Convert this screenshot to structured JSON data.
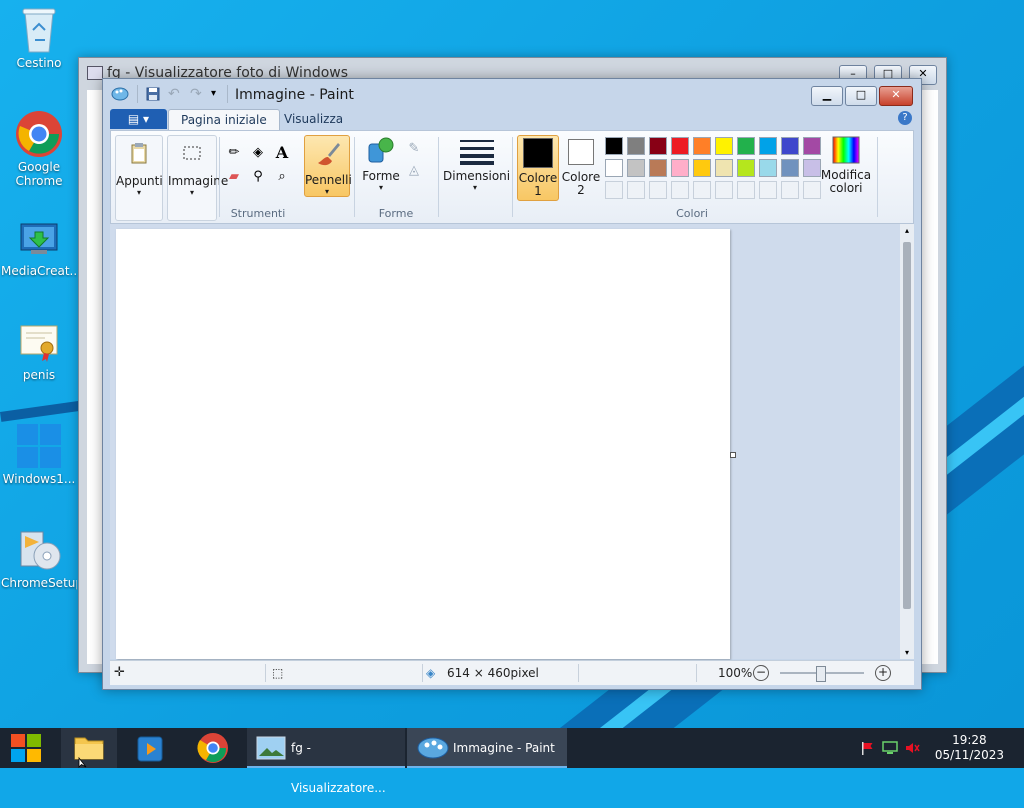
{
  "desktop": {
    "icons": [
      {
        "label": "Cestino",
        "icon": "recycle-bin-icon"
      },
      {
        "label": "Google Chrome",
        "icon": "chrome-icon"
      },
      {
        "label": "MediaCreat...",
        "icon": "media-creation-tool-icon"
      },
      {
        "label": "penis",
        "icon": "certificate-icon"
      },
      {
        "label": "Windows1...",
        "icon": "windows-logo-icon"
      },
      {
        "label": "ChromeSetup",
        "icon": "installer-icon"
      }
    ]
  },
  "viewer_window": {
    "title": "fg - Visualizzatore foto di Windows"
  },
  "paint": {
    "title": "Immagine - Paint",
    "quick_access": [
      "save-icon",
      "undo-icon",
      "redo-icon",
      "customize-dropdown-icon"
    ],
    "tabs": {
      "active": "Pagina iniziale",
      "other": "Visualizza"
    },
    "groups": {
      "appunti": "Appunti",
      "immagine": "Immagine",
      "strumenti": "Strumenti",
      "pennelli": "Pennelli",
      "forme_btn": "Forme",
      "forme_group": "Forme",
      "dimensioni": "Dimensioni",
      "colore1": "Colore 1",
      "colore2": "Colore 2",
      "colori": "Colori",
      "modifica": "Modifica colori"
    },
    "palette_row1": [
      "#000000",
      "#7f7f7f",
      "#880015",
      "#ed1c24",
      "#ff7f27",
      "#fff200",
      "#22b14c",
      "#00a2e8",
      "#3f48cc",
      "#a349a4"
    ],
    "palette_row2": [
      "#ffffff",
      "#c3c3c3",
      "#b97a57",
      "#ffaec9",
      "#ffc90e",
      "#efe4b0",
      "#b5e61d",
      "#99d9ea",
      "#7092be",
      "#c8bfe7"
    ],
    "status": {
      "dimensions": "614 × 460pixel",
      "zoom": "100%"
    }
  },
  "taskbar": {
    "tasks": [
      {
        "label": "fg - Visualizzatore..."
      },
      {
        "label": "Immagine - Paint"
      }
    ],
    "time": "19:28",
    "date": "05/11/2023"
  }
}
